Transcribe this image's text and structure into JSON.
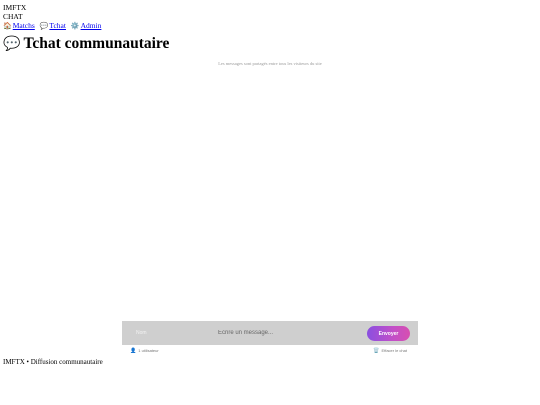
{
  "header": {
    "brand_line1": "IMFTX",
    "brand_line2": "CHAT",
    "nav": [
      {
        "icon": "🏠",
        "label": "Matchs"
      },
      {
        "icon": "💬",
        "label": "Tchat"
      },
      {
        "icon": "⚙️",
        "label": "Admin"
      }
    ]
  },
  "main": {
    "title_icon": "💬",
    "title": "Tchat communautaire",
    "subtitle": "Les messages sont partagés entre tous les visiteurs du site"
  },
  "composer": {
    "name_placeholder": "Nom",
    "message_placeholder": "Écrire un message...",
    "send_label": "Envoyer"
  },
  "meta": {
    "user_icon": "👤",
    "user_count": "1 utilisateur",
    "clear_icon": "🗑️",
    "clear_label": "Effacer le chat"
  },
  "footer": {
    "text": "IMFTX • Diffusion communautaire"
  },
  "colors": {
    "composer_bg": "#cfcfcf",
    "send_gradient_start": "#8a4fe0",
    "send_gradient_end": "#d74fb0",
    "link": "#0000ee"
  }
}
